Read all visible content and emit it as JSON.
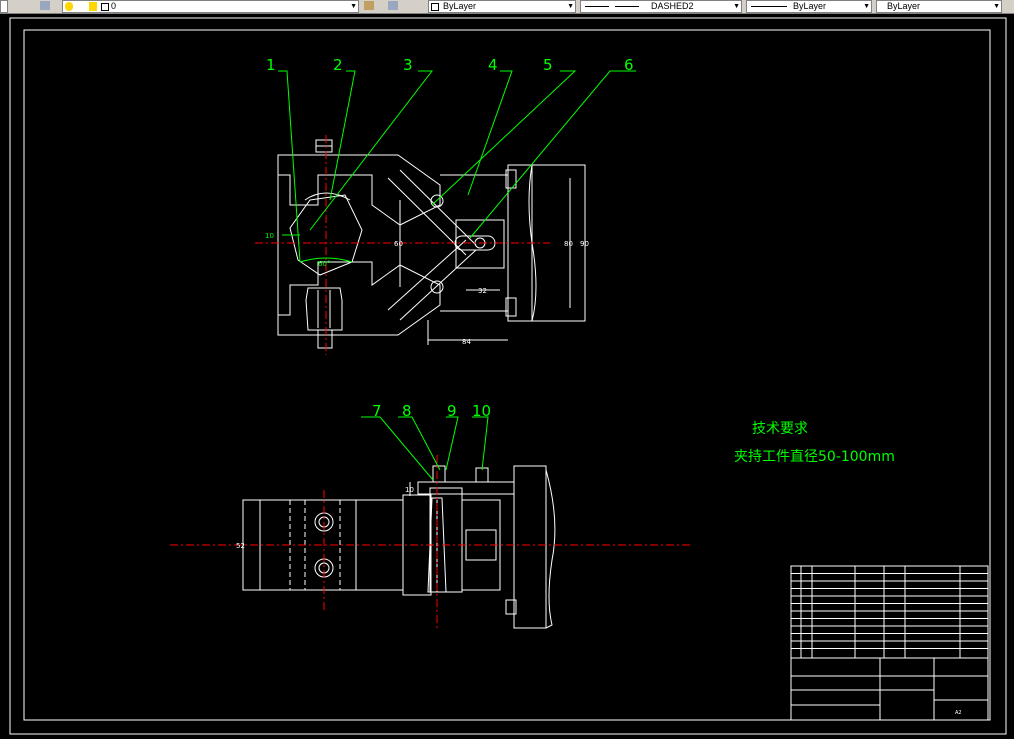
{
  "toolbar": {
    "layer_name": "0",
    "color_value": "ByLayer",
    "linetype_value": "DASHED2",
    "lineweight_value": "ByLayer",
    "plotstyle_value": "ByLayer"
  },
  "callouts": [
    "1",
    "2",
    "3",
    "4",
    "5",
    "6",
    "7",
    "8",
    "9",
    "10"
  ],
  "dimensions": {
    "d_10": "10",
    "d_60deg": "60°",
    "d_60": "60",
    "d_32": "32",
    "d_84": "84",
    "d_80": "80",
    "d_90": "90",
    "d_10b": "10",
    "d_52": "52"
  },
  "notes": {
    "title": "技术要求",
    "line1": "夹持工件直径50-100mm"
  },
  "title_block": {
    "sheet_size": "A2"
  },
  "colors": {
    "background": "#000000",
    "outline": "#ffffff",
    "centerline": "#ff0000",
    "annotation": "#00ff00"
  }
}
